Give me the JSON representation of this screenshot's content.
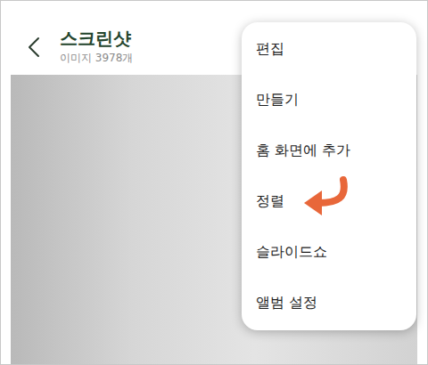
{
  "header": {
    "back_icon": "<",
    "title": "스크린샷",
    "subtitle": "이미지 3978개"
  },
  "menu": {
    "items": [
      {
        "label": "편집",
        "marked": false
      },
      {
        "label": "만들기",
        "marked": false
      },
      {
        "label": "홈 화면에 추가",
        "marked": false
      },
      {
        "label": "정렬",
        "marked": true
      },
      {
        "label": "슬라이드쇼",
        "marked": false
      },
      {
        "label": "앨범 설정",
        "marked": false
      }
    ]
  }
}
